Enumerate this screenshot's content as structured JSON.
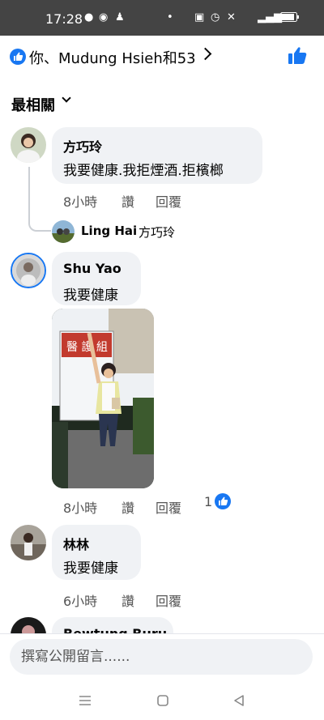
{
  "status_bar": {
    "time": "17:28"
  },
  "header": {
    "reaction_summary": "你、Mudung Hsieh和53"
  },
  "sort": {
    "label": "最相關"
  },
  "comments": [
    {
      "name": "方巧玲",
      "text": "我要健康.我拒煙酒.拒檳榔",
      "time": "8小時",
      "like": "讚",
      "reply": "回覆",
      "reply_preview": {
        "name": "Ling Hai",
        "text": "方巧玲"
      }
    },
    {
      "name": "Shu Yao",
      "text": "我要健康",
      "time": "8小時",
      "like": "讚",
      "reply": "回覆",
      "reaction_count": "1",
      "photo_sign_text": "醫 護 組"
    },
    {
      "name": "林林",
      "text": "我要健康",
      "time": "6小時",
      "like": "讚",
      "reply": "回覆"
    },
    {
      "name": "Bewtung Buru"
    }
  ],
  "composer": {
    "placeholder": "撰寫公開留言......"
  },
  "colors": {
    "accent": "#1877f2",
    "bubble": "#f0f2f5",
    "status_bar": "#444444"
  },
  "icons": [
    "like-badge-icon",
    "chevron-right-icon",
    "thumbs-up-icon",
    "chevron-down-icon",
    "menu-icon",
    "home-icon",
    "back-icon"
  ]
}
